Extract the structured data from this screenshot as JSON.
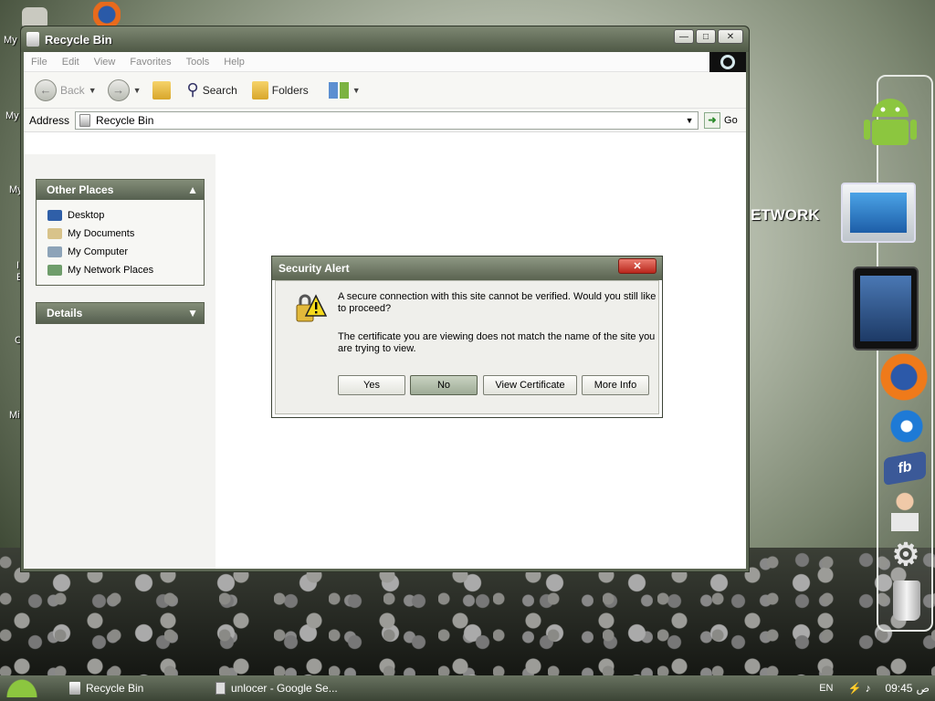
{
  "desktop": {
    "icon_labels": [
      "My",
      "My",
      "My",
      "I",
      "E",
      "C",
      "Mi"
    ],
    "background_text": "ETWORK"
  },
  "window": {
    "title": "Recycle Bin",
    "controls": [
      "minimize-icon",
      "maximize-icon",
      "close-icon"
    ]
  },
  "menu": {
    "items": [
      "File",
      "Edit",
      "View",
      "Favorites",
      "Tools",
      "Help"
    ]
  },
  "toolbar": {
    "back_label": "Back",
    "search_label": "Search",
    "folders_label": "Folders"
  },
  "address": {
    "label": "Address",
    "value": "Recycle Bin",
    "go_label": "Go"
  },
  "task_pane": {
    "other_places": {
      "title": "Other Places",
      "items": [
        "Desktop",
        "My Documents",
        "My Computer",
        "My Network Places"
      ]
    },
    "details": {
      "title": "Details"
    }
  },
  "dialog": {
    "title": "Security Alert",
    "message1": "A secure connection with this site cannot be verified. Would you still like to proceed?",
    "message2": "The certificate you are viewing does not match the name of the site you are trying to view.",
    "buttons": {
      "yes": "Yes",
      "no": "No",
      "view_certificate": "View Certificate",
      "more_info": "More Info"
    }
  },
  "dock": {
    "facebook_label": "fb"
  },
  "taskbar": {
    "tasks": [
      "Recycle Bin",
      "unlocer - Google Se..."
    ],
    "language": "EN",
    "time": "09:45",
    "ampm": "ص"
  },
  "colors": {
    "title_bar": "#5b6552",
    "close_red": "#c8392c",
    "accent": "#566050"
  }
}
